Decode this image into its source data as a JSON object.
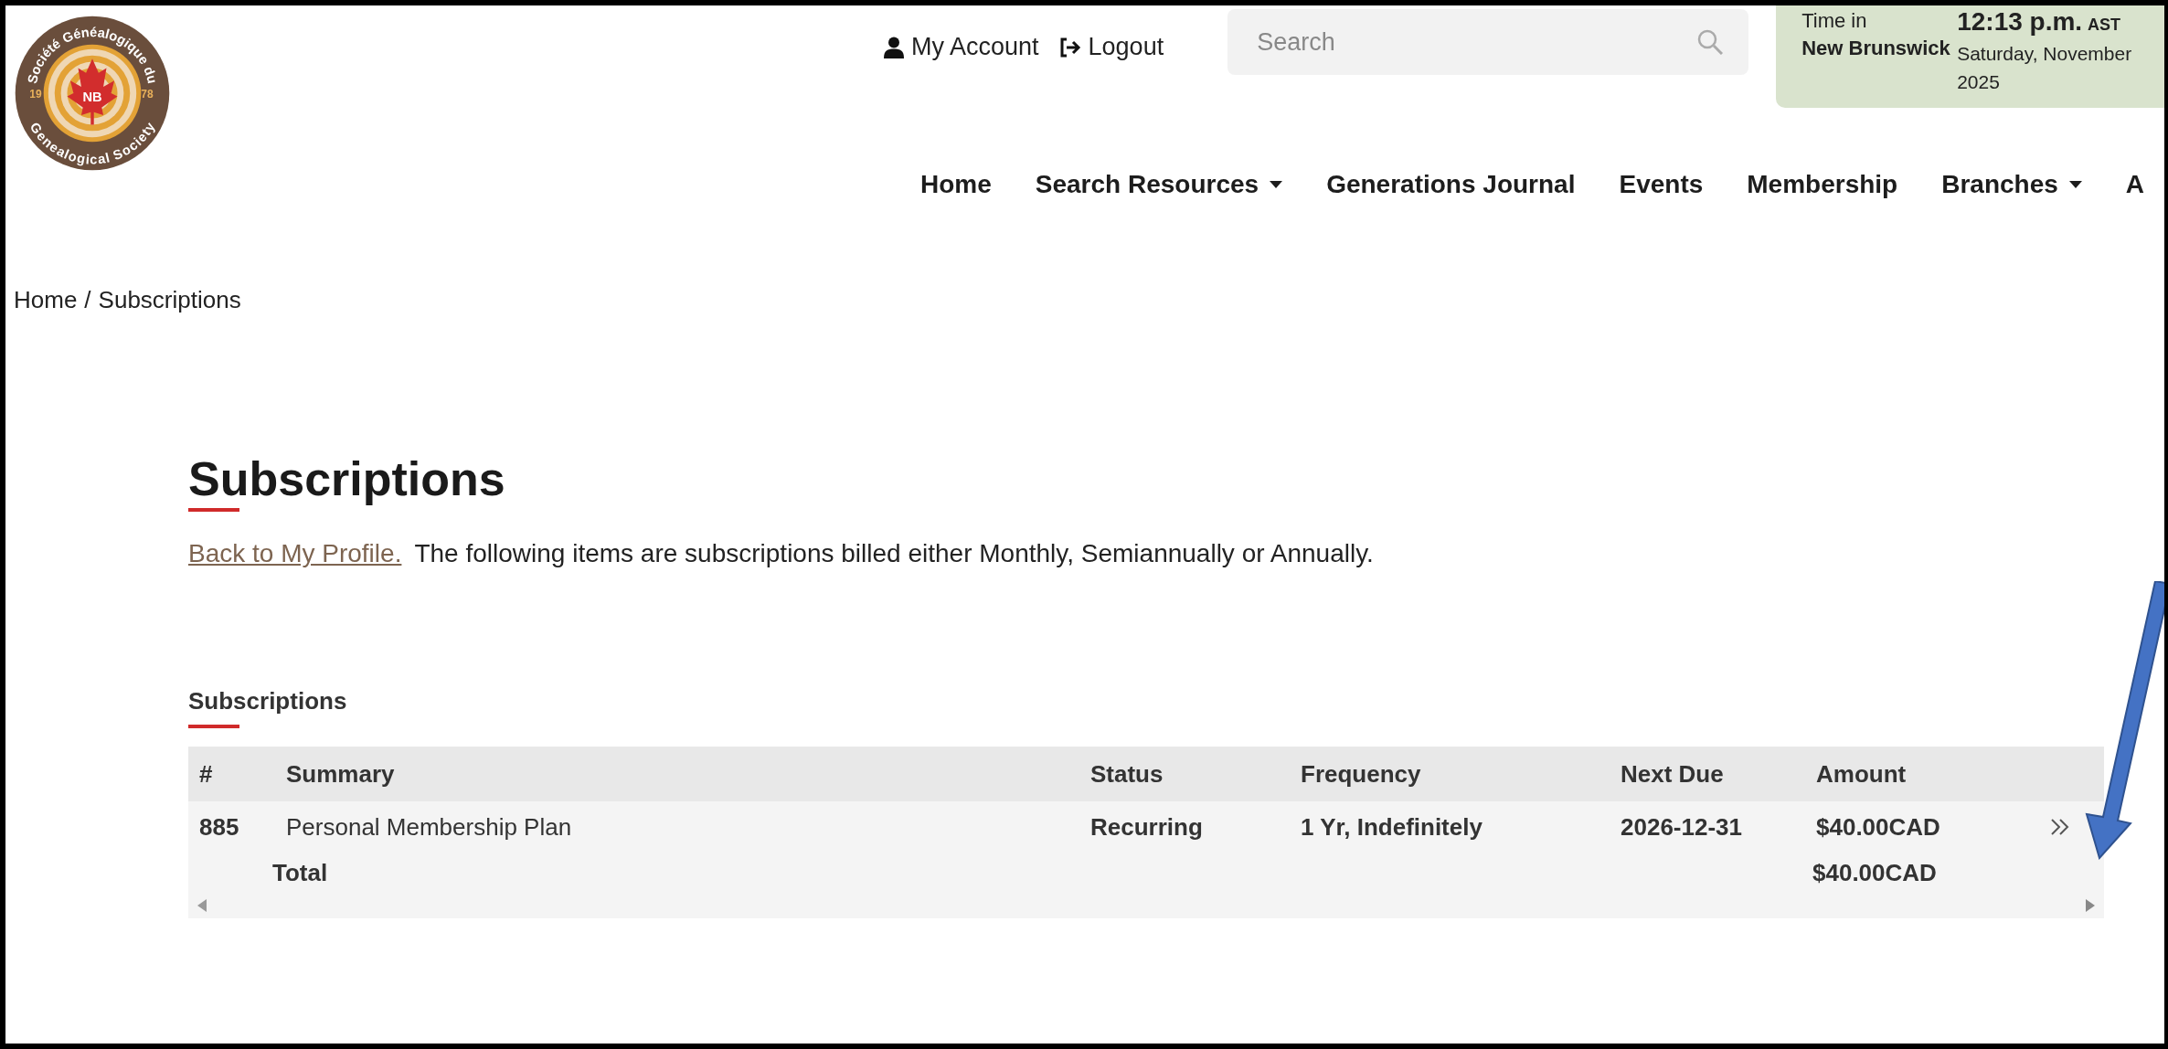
{
  "logo": {
    "top_text": "Société Généalogique du",
    "bottom_text": "Genealogical Society",
    "left_year": "19",
    "right_year": "78",
    "badge": "NB"
  },
  "account_links": [
    {
      "label": "My Account",
      "kind": "account"
    },
    {
      "label": "Logout",
      "kind": "logout"
    }
  ],
  "search": {
    "placeholder": "Search"
  },
  "clock": {
    "label": "Time in",
    "region": "New Brunswick",
    "time": "12:13 p.m.",
    "zone": "AST",
    "date": "Saturday, November",
    "year": "2025"
  },
  "nav": [
    {
      "label": "Home",
      "dropdown": false
    },
    {
      "label": "Search Resources",
      "dropdown": true
    },
    {
      "label": "Generations Journal",
      "dropdown": false
    },
    {
      "label": "Events",
      "dropdown": false
    },
    {
      "label": "Membership",
      "dropdown": false
    },
    {
      "label": "Branches",
      "dropdown": true
    },
    {
      "label": "A",
      "dropdown": false
    }
  ],
  "breadcrumb": {
    "items": [
      "Home",
      "Subscriptions"
    ],
    "separator": "/"
  },
  "page": {
    "title": "Subscriptions",
    "back_link": "Back to My Profile.",
    "intro": "The following items are subscriptions billed either Monthly, Semiannually or Annually."
  },
  "table": {
    "title": "Subscriptions",
    "columns": [
      "#",
      "Summary",
      "Status",
      "Frequency",
      "Next Due",
      "Amount"
    ],
    "rows": [
      {
        "cells": [
          "885",
          "Personal Membership Plan",
          "Recurring",
          "1 Yr, Indefinitely",
          "2026-12-31",
          "$40.00CAD"
        ]
      }
    ],
    "total": {
      "label": "Total",
      "amount": "$40.00CAD"
    }
  },
  "annotations": [
    {
      "kind": "arrow"
    }
  ]
}
